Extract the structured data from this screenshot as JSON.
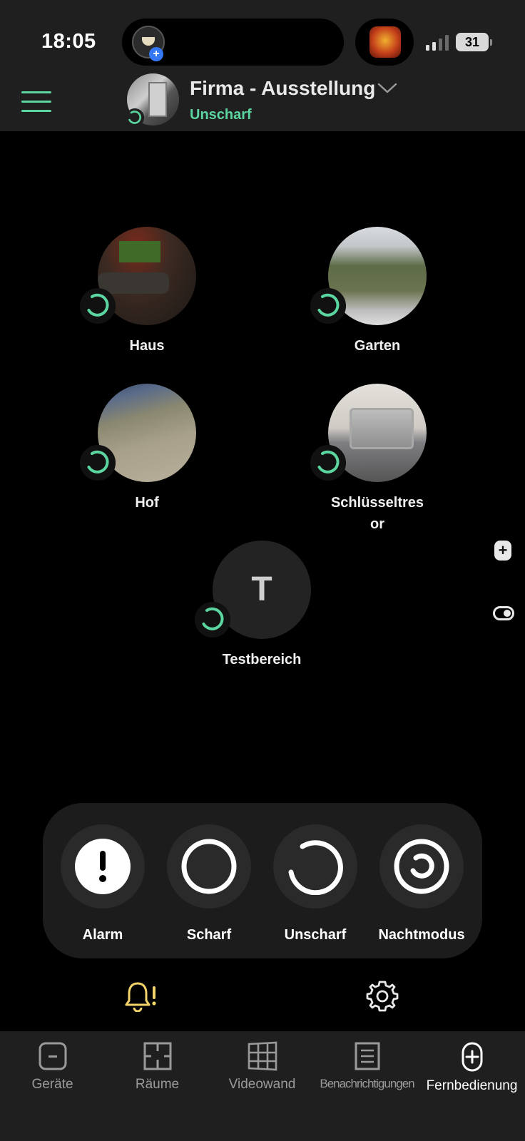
{
  "status_bar": {
    "time": "18:05",
    "battery": "31"
  },
  "header": {
    "site_name": "Firma - Ausstellung",
    "site_state": "Unscharf"
  },
  "areas": [
    {
      "label": "Haus",
      "icon": "disarmed-ring-icon"
    },
    {
      "label": "Garten",
      "icon": "disarmed-ring-icon"
    },
    {
      "label": "Hof",
      "icon": "disarmed-ring-icon"
    },
    {
      "label": "Schlüsseltres\nor",
      "icon": "disarmed-ring-icon"
    },
    {
      "label": "Testbereich",
      "initial": "T",
      "icon": "disarmed-ring-icon"
    }
  ],
  "controls": [
    {
      "label": "Alarm",
      "icon": "alarm-icon"
    },
    {
      "label": "Scharf",
      "icon": "armed-ring-icon"
    },
    {
      "label": "Unscharf",
      "icon": "disarmed-ring-icon"
    },
    {
      "label": "Nachtmodus",
      "icon": "night-mode-icon"
    }
  ],
  "nav": [
    {
      "label": "Geräte",
      "icon": "devices-icon"
    },
    {
      "label": "Räume",
      "icon": "rooms-icon"
    },
    {
      "label": "Videowand",
      "icon": "videowall-icon"
    },
    {
      "label": "Benachrichtigungen",
      "icon": "notifications-list-icon"
    },
    {
      "label": "Fernbedienung",
      "icon": "remote-control-icon",
      "active": true
    }
  ],
  "colors": {
    "accent_green": "#5cd6a0",
    "bell_yellow": "#f2d46a",
    "header_bg": "#1f1f1f",
    "panel_bg": "#1c1c1c"
  }
}
